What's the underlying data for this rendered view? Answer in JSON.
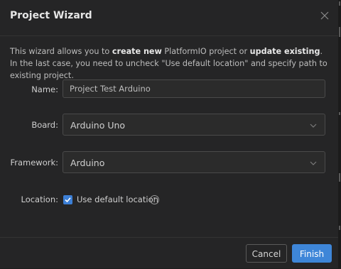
{
  "dialog": {
    "title": "Project Wizard",
    "close_icon": "close-icon",
    "description": {
      "part1": "This wizard allows you to ",
      "bold1": "create new",
      "part2": " PlatformIO project or ",
      "bold2": "update existing",
      "part3": ". In the last case, you need to uncheck \"Use default location\" and specify path to existing project."
    }
  },
  "form": {
    "name": {
      "label": "Name:",
      "value": "Project Test Arduino"
    },
    "board": {
      "label": "Board:",
      "value": "Arduino Uno",
      "icon": "chevron-down-icon"
    },
    "framework": {
      "label": "Framework:",
      "value": "Arduino",
      "icon": "chevron-down-icon"
    },
    "location": {
      "label": "Location:",
      "checkbox_label": "Use default location",
      "checked": true,
      "help_icon": "question-circle-icon"
    }
  },
  "footer": {
    "cancel_label": "Cancel",
    "finish_label": "Finish"
  },
  "colors": {
    "background": "#252526",
    "accent": "#3e86d8",
    "text": "#cccccc"
  }
}
